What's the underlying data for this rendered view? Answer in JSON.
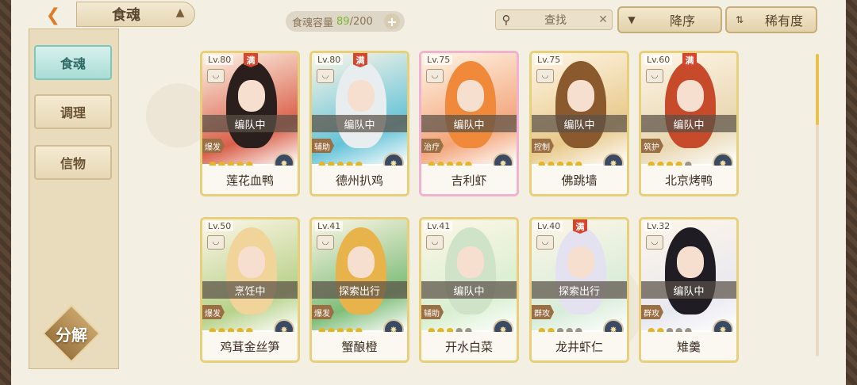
{
  "header": {
    "title": "食魂",
    "capacity_label": "食魂容量",
    "capacity_current": "89",
    "capacity_total": "/200",
    "add_symbol": "+",
    "search_placeholder": "查找",
    "sort_order": "降序",
    "sort_key": "稀有度"
  },
  "sidebar": {
    "tabs": [
      {
        "label": "食魂",
        "active": true
      },
      {
        "label": "调理",
        "active": false
      },
      {
        "label": "信物",
        "active": false
      }
    ],
    "decompose_label": "分解"
  },
  "cards": [
    {
      "level": "Lv.80",
      "max": "满",
      "status": "编队中",
      "role": "爆发",
      "stars": 5,
      "name": "莲花血鸭",
      "bg": "#d9604a",
      "hair": "#2a1f1c",
      "frame": "gold"
    },
    {
      "level": "Lv.80",
      "max": "满",
      "status": "编队中",
      "role": "辅助",
      "stars": 5,
      "name": "德州扒鸡",
      "bg": "#65c3d8",
      "hair": "#e8eef0",
      "frame": "gold"
    },
    {
      "level": "Lv.75",
      "max": "",
      "status": "编队中",
      "role": "治疗",
      "stars": 5,
      "name": "吉利虾",
      "bg": "#f3a57a",
      "hair": "#f08a3a",
      "frame": "pink"
    },
    {
      "level": "Lv.75",
      "max": "",
      "status": "编队中",
      "role": "控制",
      "stars": 5,
      "name": "佛跳墙",
      "bg": "#e8c98a",
      "hair": "#8a5a2e",
      "frame": "gold"
    },
    {
      "level": "Lv.60",
      "max": "满",
      "status": "编队中",
      "role": "筑护",
      "stars": 4,
      "name": "北京烤鸭",
      "bg": "#e8d6b0",
      "hair": "#c74a2a",
      "frame": "gold"
    },
    {
      "level": "Lv.50",
      "max": "",
      "status": "烹饪中",
      "role": "爆发",
      "stars": 5,
      "name": "鸡茸金丝笋",
      "bg": "#b7d28a",
      "hair": "#f0d49a",
      "frame": "gold"
    },
    {
      "level": "Lv.41",
      "max": "",
      "status": "探索出行",
      "role": "爆发",
      "stars": 5,
      "name": "蟹酿橙",
      "bg": "#7fbe7a",
      "hair": "#e8b34a",
      "frame": "gold"
    },
    {
      "level": "Lv.41",
      "max": "",
      "status": "编队中",
      "role": "辅助",
      "stars": 3,
      "name": "开水白菜",
      "bg": "#d8efd0",
      "hair": "#cfe3c8",
      "frame": "gold"
    },
    {
      "level": "Lv.40",
      "max": "满",
      "status": "探索出行",
      "role": "群攻",
      "stars": 2,
      "name": "龙井虾仁",
      "bg": "#d7ecd8",
      "hair": "#e4e2f0",
      "frame": "gold"
    },
    {
      "level": "Lv.32",
      "max": "",
      "status": "编队中",
      "role": "群攻",
      "stars": 2,
      "name": "雉羹",
      "bg": "#e8e8f0",
      "hair": "#1f1c24",
      "frame": "gold"
    }
  ]
}
